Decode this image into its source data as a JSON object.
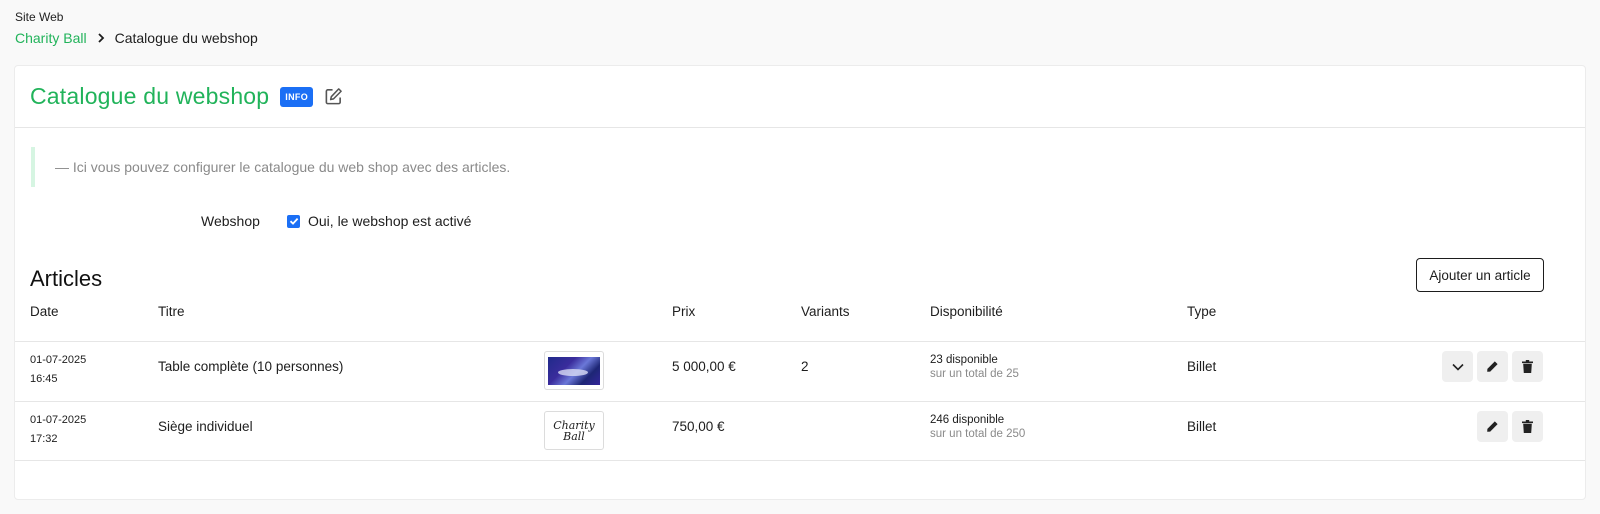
{
  "breadcrumb": {
    "site_label": "Site Web",
    "parent": "Charity Ball",
    "current": "Catalogue du webshop"
  },
  "header": {
    "title": "Catalogue du webshop",
    "badge": "INFO"
  },
  "note": "— Ici vous pouvez configurer le catalogue du web shop avec des articles.",
  "webshop": {
    "label": "Webshop",
    "checkbox_label": "Oui, le webshop est activé",
    "checked": true
  },
  "articles": {
    "title": "Articles",
    "add_button": "Ajouter un article",
    "columns": [
      "Date",
      "Titre",
      "Prix",
      "Variants",
      "Disponibilité",
      "Type"
    ],
    "rows": [
      {
        "date": "01-07-2025",
        "time": "16:45",
        "title": "Table complète (10 personnes)",
        "image": "event-photo",
        "price": "5 000,00 €",
        "variants": "2",
        "available": "23 disponible",
        "total": "sur un total de 25",
        "type": "Billet"
      },
      {
        "date": "01-07-2025",
        "time": "17:32",
        "title": "Siège individuel",
        "image": "charity-ball-logo",
        "logo_text": "Charity Ball",
        "price": "750,00 €",
        "variants": "",
        "available": "246 disponible",
        "total": "sur un total de 250",
        "type": "Billet"
      }
    ]
  },
  "colors": {
    "accent": "#21b35a",
    "badge": "#1b6ff5"
  }
}
